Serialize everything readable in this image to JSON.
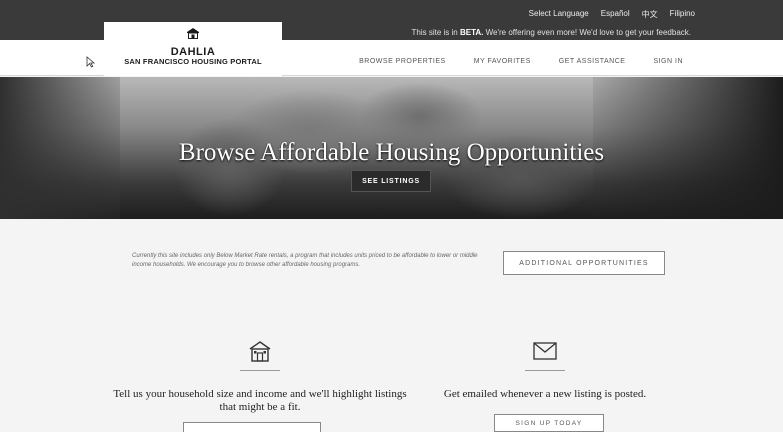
{
  "topbar": {
    "select_language": "Select Language",
    "languages": [
      "Español",
      "中文",
      "Filipino"
    ],
    "beta_prefix": "This site is in ",
    "beta_word": "BETA.",
    "beta_suffix": " We're offering even more! We'd love to get your feedback."
  },
  "logo": {
    "title": "DAHLIA",
    "subtitle": "SAN FRANCISCO HOUSING PORTAL"
  },
  "nav": {
    "items": [
      "BROWSE PROPERTIES",
      "MY FAVORITES",
      "GET ASSISTANCE",
      "SIGN IN"
    ]
  },
  "hero": {
    "title": "Browse Affordable Housing Opportunities",
    "button_label": "SEE LISTINGS"
  },
  "info": {
    "text": "Currently this site includes only Below Market Rate rentals, a program that includes units priced to be affordable to lower or middle income households. We encourage you to browse other affordable housing programs.",
    "button_label": "ADDITIONAL OPPORTUNITIES"
  },
  "features": {
    "household_text": "Tell us your household size and income and we'll highlight listings that might be a fit.",
    "email_text": "Get emailed whenever a new listing is posted.",
    "signup_label": "SIGN UP TODAY"
  },
  "icons": {
    "logo": "house-icon",
    "household": "house-icon",
    "email": "envelope-icon",
    "cursor": "cursor-icon"
  }
}
